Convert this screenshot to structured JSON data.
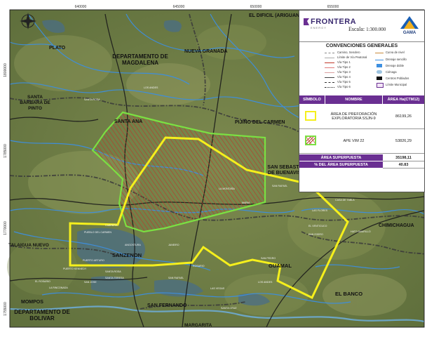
{
  "map": {
    "coord_top": [
      "640000",
      "645000",
      "650000",
      "655000"
    ],
    "coord_left": [
      "1800000",
      "1785000",
      "1770000",
      "1755000"
    ],
    "region_labels": {
      "el_dificil": "EL DIFICIL (ARIGUANI)",
      "plato": "PLATO",
      "nueva_granada": "NUEVA GRANADA",
      "dpto_magdalena": "DEPARTAMENTO DE",
      "dpto_magdalena_2": "MAGDALENA",
      "santa_barbara": "SANTA",
      "santa_barbara_2": "BARBARA DE",
      "santa_barbara_3": "PINTO",
      "santa_ana": "SANTA ANA",
      "pijino": "PIJIÑO DEL CARMEN",
      "san_sebastian": "SAN SEBASTIAN",
      "san_sebastian_2": "DE BUENAVISTA",
      "chimichagua": "CHIMICHAGUA",
      "talaigua": "TALAIGUA NUEVO",
      "sanzenon": "SANZENON",
      "guamal": "GUAMAL",
      "el_banco": "EL BANCO",
      "mompos": "MOMPOS",
      "dpto_bolivar": "DEPARTAMENTO DE",
      "dpto_bolivar_2": "BOLIVAR",
      "san_fernando": "SAN FERNANDO",
      "margarita": "MARGARITA"
    },
    "small_labels": [
      "LOS ANDES",
      "SANTA ROSA",
      "CABRERA",
      "PUEBLO DEL CARMEN",
      "ANGOSTURA",
      "JANEIRO",
      "LA MONTAÑA",
      "MARIA",
      "SAN RAFAEL",
      "CASA DE TABLA",
      "SAN ISIDRO",
      "HATO AMARILLO",
      "EL VENTICUCO",
      "LAS FLORES",
      "ROSARIO",
      "SAN PEDRO",
      "LOS ANDES",
      "PUERTO ARTURO",
      "PUERTO KENNEDY",
      "SANTA ROSA",
      "SANTA TERESA",
      "SAN JOSE",
      "SAN RAFAEL",
      "LA RINCONADA",
      "EL ROSARIO",
      "LAS VEGAS",
      "SANTA CRUZ"
    ]
  },
  "header": {
    "brand": "FRONTERA",
    "brand_sub": "ENERGY",
    "scale_label": "Escala:",
    "scale_value": "1:300.000",
    "partner": "GAMA"
  },
  "legend": {
    "title": "CONVENCIONES GENERALES",
    "left": [
      "Camino, Sendero",
      "Límite de Vía Peatonal",
      "Vía Tipo 1",
      "Vía Tipo 2",
      "Vía Tipo 3",
      "Vía Tipo 4",
      "Vía Tipo 5",
      "Vía Tipo 6"
    ],
    "right": [
      "Curva de nivel",
      "Drenaje sencillo",
      "Drenaje doble",
      "Ciénaga",
      "Centros Poblados",
      "Límite Municipal"
    ]
  },
  "table": {
    "headers": [
      "SÍMBOLO",
      "NOMBRE",
      "ÁREA  Ha(CTM12)"
    ],
    "rows": [
      {
        "name": "ÁREA DE PREFORACIÓN EXPLORATORIA SSJN-9",
        "area": "86199,26"
      },
      {
        "name": "APE VIM 22",
        "area": "53826,29"
      }
    ],
    "footer": [
      {
        "label": "ÁREA SUPERPUESTA",
        "value": "35198,11"
      },
      {
        "label": "% DEL ÁREA SUPERPUESTA",
        "value": "40.83"
      }
    ]
  },
  "colors": {
    "yellow_polygon": "#f5ef1c",
    "green_polygon": "#7be042",
    "hatch": "#c0392b",
    "river": "#3d8fe0",
    "road": "#1b1b1b",
    "accent": "#6a2f92"
  }
}
